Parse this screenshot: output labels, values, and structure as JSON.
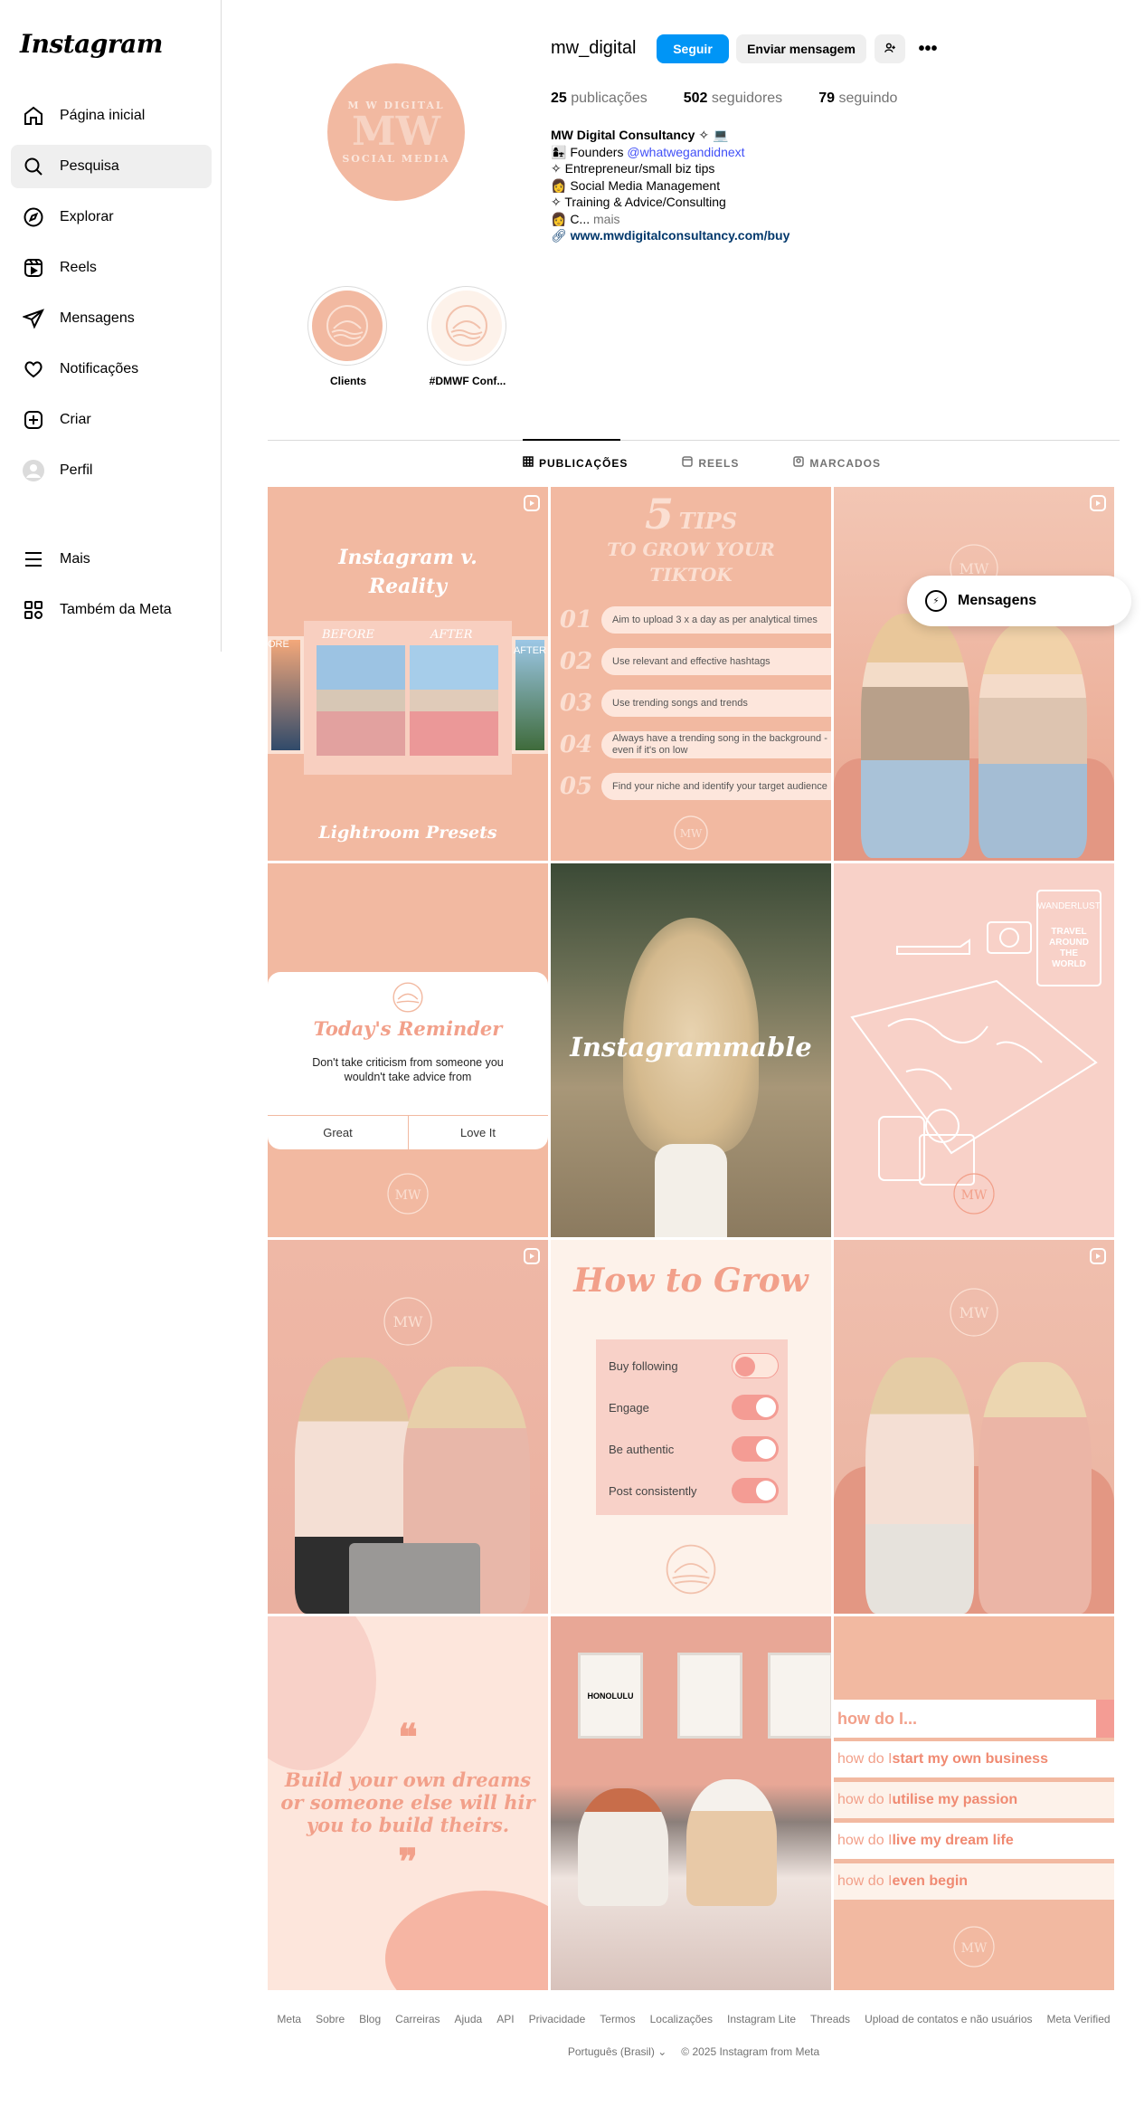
{
  "app": {
    "logo": "Instagram"
  },
  "sidebar": {
    "items": [
      {
        "label": "Página inicial",
        "icon": "home-icon"
      },
      {
        "label": "Pesquisa",
        "icon": "search-icon"
      },
      {
        "label": "Explorar",
        "icon": "compass-icon"
      },
      {
        "label": "Reels",
        "icon": "reels-icon"
      },
      {
        "label": "Mensagens",
        "icon": "send-icon"
      },
      {
        "label": "Notificações",
        "icon": "heart-icon"
      },
      {
        "label": "Criar",
        "icon": "plus-square-icon"
      },
      {
        "label": "Perfil",
        "icon": "avatar-icon"
      }
    ],
    "bottom": [
      {
        "label": "Mais",
        "icon": "menu-icon"
      },
      {
        "label": "Também da Meta",
        "icon": "meta-apps-icon"
      }
    ]
  },
  "profile": {
    "username": "mw_digital",
    "avatar_text": [
      "M W DIGITAL",
      "MW",
      "SOCIAL MEDIA"
    ],
    "follow_label": "Seguir",
    "message_label": "Enviar mensagem",
    "stats": {
      "posts_count": "25",
      "posts_label": "publicações",
      "followers_count": "502",
      "followers_label": "seguidores",
      "following_count": "79",
      "following_label": "seguindo"
    },
    "bio": {
      "name": "MW Digital Consultancy ✧ 💻",
      "line1_prefix": "👩‍👧 Founders ",
      "line1_mention": "@whatwegandidnext",
      "line2": "✧ Entrepreneur/small biz tips",
      "line3": "👩 Social Media Management",
      "line4": "✧ Training & Advice/Consulting",
      "line5": "👩 C...",
      "more": " mais",
      "link": "www.mwdigitalconsultancy.com/buy"
    }
  },
  "highlights": [
    {
      "label": "Clients"
    },
    {
      "label": "#DMWF Conf..."
    }
  ],
  "tabs": [
    {
      "label": "PUBLICAÇÕES",
      "icon": "grid-icon"
    },
    {
      "label": "REELS",
      "icon": "reels-tab-icon"
    },
    {
      "label": "MARCADOS",
      "icon": "tagged-icon"
    }
  ],
  "posts": {
    "p1": {
      "title1": "Instagram v.",
      "title2": "Reality",
      "before": "BEFORE",
      "after": "AFTER",
      "footer": "Lightroom Presets",
      "left_tag": "ORE",
      "right_tag": "AFTER"
    },
    "p2": {
      "title1": "5",
      "title2": "TIPS",
      "title3": "TO GROW YOUR",
      "title4": "TIKTOK",
      "tips": [
        {
          "n": "01",
          "t": "Aim to upload 3 x a day as per analytical times"
        },
        {
          "n": "02",
          "t": "Use relevant and effective hashtags"
        },
        {
          "n": "03",
          "t": "Use trending songs and trends"
        },
        {
          "n": "04",
          "t": "Always have a trending song in the background - even if it's on low"
        },
        {
          "n": "05",
          "t": "Find your niche and identify your target audience"
        }
      ]
    },
    "p4": {
      "title": "Today's Reminder",
      "body": "Don't take criticism from someone you wouldn't take advice from",
      "btn1": "Great",
      "btn2": "Love It"
    },
    "p5": {
      "title": "Instagrammable"
    },
    "p6": {
      "sign1": "WANDERLUST",
      "sign2": "TRAVEL AROUND THE WORLD"
    },
    "p8": {
      "title": "How to Grow",
      "toggles": [
        {
          "label": "Buy following",
          "on": false
        },
        {
          "label": "Engage",
          "on": true
        },
        {
          "label": "Be authentic",
          "on": true
        },
        {
          "label": "Post consistently",
          "on": true
        }
      ]
    },
    "p10": {
      "quote1": "Build your own dreams",
      "quote2": "or someone else will hir",
      "quote3": "you to build theirs."
    },
    "p11": {
      "sign": "HONOLULU"
    },
    "p12": {
      "search": "how do I...",
      "rows": [
        {
          "prefix": "how do I ",
          "bold": "start my own business"
        },
        {
          "prefix": "how do I ",
          "bold": "utilise my passion"
        },
        {
          "prefix": "how do I ",
          "bold": "live my dream life"
        },
        {
          "prefix": "how do I ",
          "bold": "even begin"
        }
      ]
    }
  },
  "messages_pill": {
    "label": "Mensagens"
  },
  "footer": {
    "links": [
      "Meta",
      "Sobre",
      "Blog",
      "Carreiras",
      "Ajuda",
      "API",
      "Privacidade",
      "Termos",
      "Localizações",
      "Instagram Lite",
      "Threads",
      "Upload de contatos e não usuários",
      "Meta Verified"
    ],
    "language": "Português (Brasil)",
    "copyright": "© 2025 Instagram from Meta"
  },
  "colors": {
    "accent": "#0095f6",
    "salmon": "#f2b9a1",
    "blush": "#f8d1c8"
  }
}
